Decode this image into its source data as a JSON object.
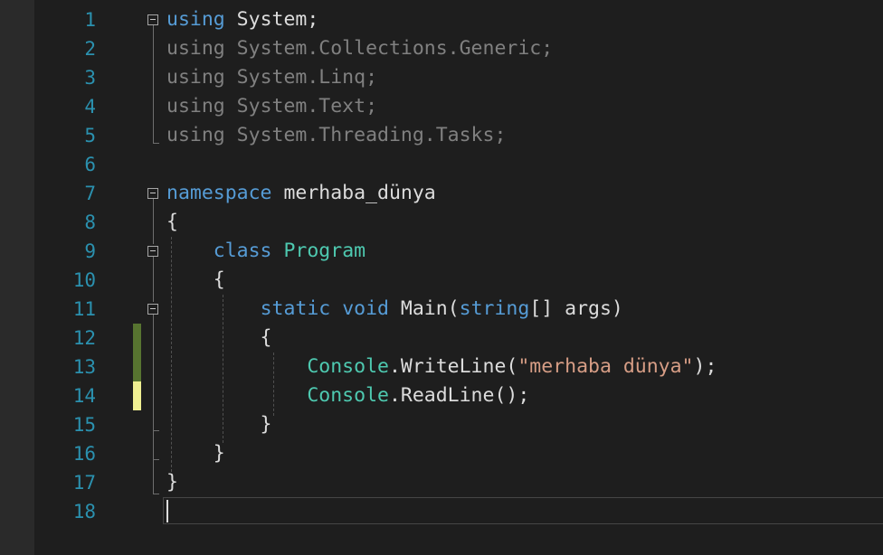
{
  "colors": {
    "background": "#1e1e1e",
    "line_number": "#2b91af",
    "keyword": "#569cd6",
    "type": "#4ec9b0",
    "string": "#d69d85",
    "text": "#dcdcdc",
    "dimmed_using": "#808080",
    "change_saved": "#577430",
    "change_unsaved": "#efef91"
  },
  "lines": [
    {
      "n": "1",
      "t": [
        {
          "c": "kw",
          "v": "using"
        },
        {
          "c": "",
          "v": " System;"
        }
      ]
    },
    {
      "n": "2",
      "t": [
        {
          "c": "dim",
          "v": "using"
        },
        {
          "c": "dim",
          "v": " System.Collections.Generic;"
        }
      ]
    },
    {
      "n": "3",
      "t": [
        {
          "c": "dim",
          "v": "using"
        },
        {
          "c": "dim",
          "v": " System.Linq;"
        }
      ]
    },
    {
      "n": "4",
      "t": [
        {
          "c": "dim",
          "v": "using"
        },
        {
          "c": "dim",
          "v": " System.Text;"
        }
      ]
    },
    {
      "n": "5",
      "t": [
        {
          "c": "dim",
          "v": "using"
        },
        {
          "c": "dim",
          "v": " System.Threading.Tasks;"
        }
      ]
    },
    {
      "n": "6",
      "t": []
    },
    {
      "n": "7",
      "t": [
        {
          "c": "kw",
          "v": "namespace"
        },
        {
          "c": "",
          "v": " merhaba_dünya"
        }
      ]
    },
    {
      "n": "8",
      "t": [
        {
          "c": "",
          "v": "{"
        }
      ]
    },
    {
      "n": "9",
      "t": [
        {
          "c": "",
          "v": "    "
        },
        {
          "c": "kw",
          "v": "class"
        },
        {
          "c": "",
          "v": " "
        },
        {
          "c": "type",
          "v": "Program"
        }
      ]
    },
    {
      "n": "10",
      "t": [
        {
          "c": "",
          "v": "    {"
        }
      ]
    },
    {
      "n": "11",
      "t": [
        {
          "c": "",
          "v": "        "
        },
        {
          "c": "kw",
          "v": "static"
        },
        {
          "c": "",
          "v": " "
        },
        {
          "c": "kw",
          "v": "void"
        },
        {
          "c": "",
          "v": " Main("
        },
        {
          "c": "kw",
          "v": "string"
        },
        {
          "c": "",
          "v": "[] args)"
        }
      ]
    },
    {
      "n": "12",
      "t": [
        {
          "c": "",
          "v": "        {"
        }
      ]
    },
    {
      "n": "13",
      "t": [
        {
          "c": "",
          "v": "            "
        },
        {
          "c": "type",
          "v": "Console"
        },
        {
          "c": "",
          "v": ".WriteLine("
        },
        {
          "c": "str",
          "v": "\"merhaba dünya\""
        },
        {
          "c": "",
          "v": ");"
        }
      ]
    },
    {
      "n": "14",
      "t": [
        {
          "c": "",
          "v": "            "
        },
        {
          "c": "type",
          "v": "Console"
        },
        {
          "c": "",
          "v": ".ReadLine();"
        }
      ]
    },
    {
      "n": "15",
      "t": [
        {
          "c": "",
          "v": "        }"
        }
      ]
    },
    {
      "n": "16",
      "t": [
        {
          "c": "",
          "v": "    }"
        }
      ]
    },
    {
      "n": "17",
      "t": [
        {
          "c": "",
          "v": "}"
        }
      ]
    },
    {
      "n": "18",
      "t": []
    }
  ]
}
